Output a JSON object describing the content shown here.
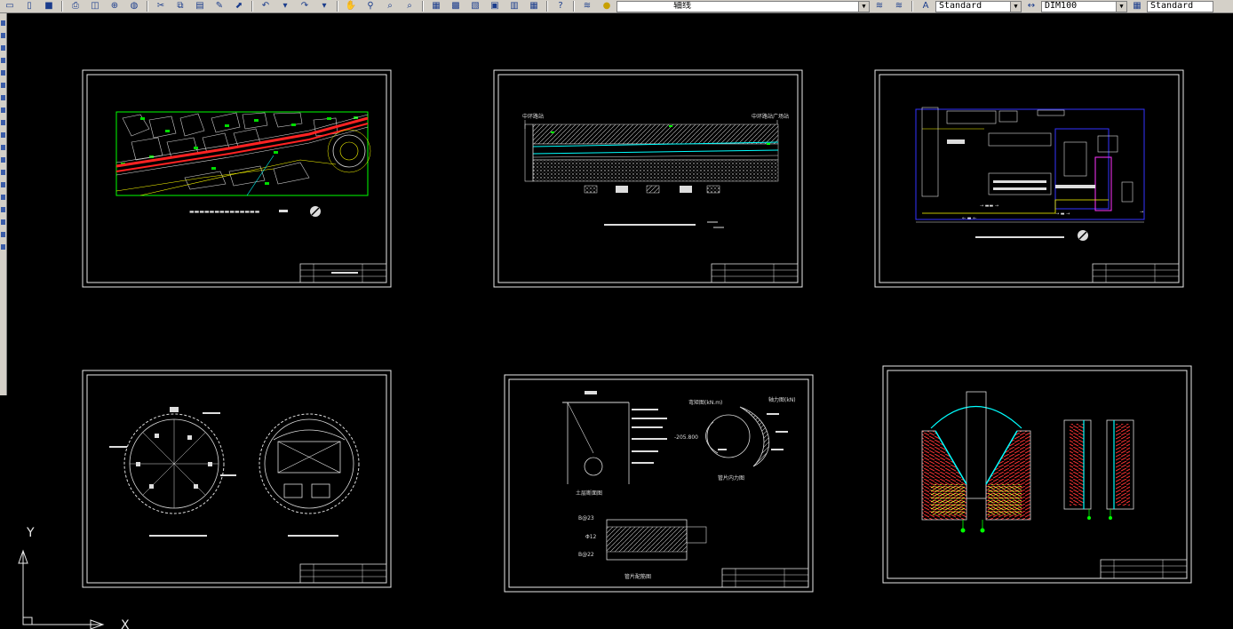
{
  "toolbar": {
    "layer_name": "轴线",
    "text_style": "Standard",
    "dim_style": "DIM100",
    "table_style": "Standard"
  },
  "ucs": {
    "y_label": "Y",
    "x_label": "X"
  },
  "drawings": {
    "sheet2": {
      "label_left": "中环路站",
      "label_right": "中环路站广场站"
    },
    "sheet5": {
      "label_section": "土层断面图",
      "label_a": "弯矩图(kN.m)",
      "label_b": "轴力图(kN)",
      "value": "-205.800",
      "label_c": "管片内力图",
      "rebar1": "B@23",
      "rebar2": "Φ12",
      "rebar3": "B@22",
      "label_d": "管片配筋图"
    }
  },
  "colors": {
    "background": "#000000",
    "line_white": "#e8e8e8",
    "green": "#00ff00",
    "red": "#ff0000",
    "cyan": "#00ffff",
    "blue": "#0000ff",
    "yellow": "#ffff00",
    "magenta": "#ff00ff"
  }
}
